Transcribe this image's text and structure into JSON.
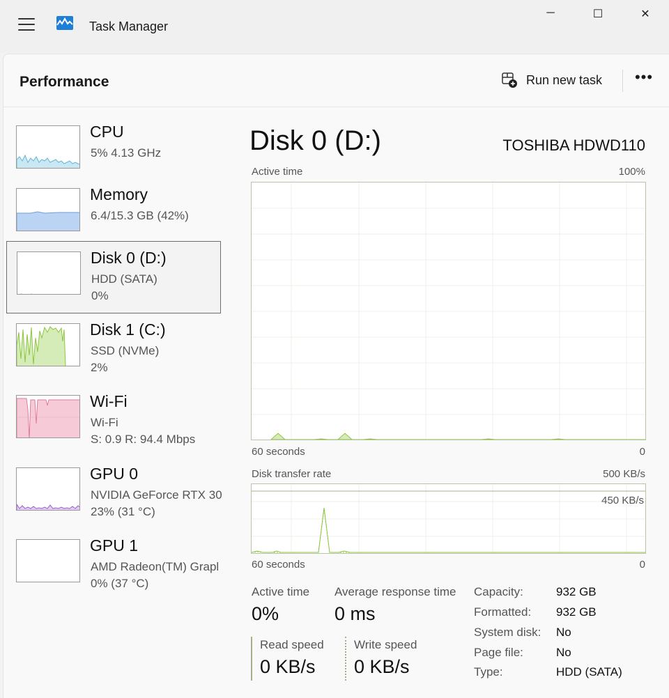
{
  "window": {
    "title": "Task Manager",
    "minimize": "─",
    "maximize": "☐",
    "close": "✕"
  },
  "header": {
    "page_title": "Performance",
    "run_new_task": "Run new task",
    "more": "•••"
  },
  "sidebar": {
    "items": [
      {
        "name": "CPU",
        "line1": "5%  4.13 GHz",
        "line2": ""
      },
      {
        "name": "Memory",
        "line1": "6.4/15.3 GB (42%)",
        "line2": ""
      },
      {
        "name": "Disk 0 (D:)",
        "line1": "HDD (SATA)",
        "line2": "0%"
      },
      {
        "name": "Disk 1 (C:)",
        "line1": "SSD (NVMe)",
        "line2": "2%"
      },
      {
        "name": "Wi-Fi",
        "line1": "Wi-Fi",
        "line2": "S: 0.9  R: 94.4 Mbps"
      },
      {
        "name": "GPU 0",
        "line1": "NVIDIA GeForce RTX 30",
        "line2": "23%  (31 °C)"
      },
      {
        "name": "GPU 1",
        "line1": "AMD Radeon(TM) Grapl",
        "line2": "0%  (37 °C)"
      }
    ]
  },
  "detail": {
    "title": "Disk 0 (D:)",
    "model": "TOSHIBA HDWD110",
    "active_graph": {
      "label": "Active time",
      "max": "100%",
      "time": "60 seconds",
      "min": "0"
    },
    "transfer_graph": {
      "label": "Disk transfer rate",
      "max": "500 KB/s",
      "line_label": "450 KB/s",
      "time": "60 seconds",
      "min": "0"
    },
    "stats": {
      "active_time_label": "Active time",
      "active_time_value": "0%",
      "avg_response_label": "Average response time",
      "avg_response_value": "0 ms",
      "read_label": "Read speed",
      "read_value": "0 KB/s",
      "write_label": "Write speed",
      "write_value": "0 KB/s"
    },
    "info": [
      {
        "k": "Capacity:",
        "v": "932 GB"
      },
      {
        "k": "Formatted:",
        "v": "932 GB"
      },
      {
        "k": "System disk:",
        "v": "No"
      },
      {
        "k": "Page file:",
        "v": "No"
      },
      {
        "k": "Type:",
        "v": "HDD (SATA)"
      }
    ]
  },
  "colors": {
    "cpu": "#5fb6d6",
    "memory": "#8fb8e8",
    "disk": "#8cc63f",
    "wifi": "#e07a98",
    "gpu": "#9b59d0"
  }
}
